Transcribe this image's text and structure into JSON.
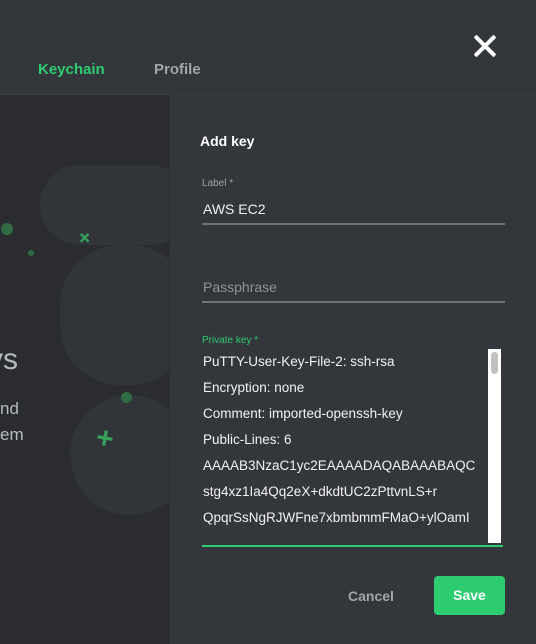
{
  "tabs": {
    "keychain": "Keychain",
    "profile": "Profile"
  },
  "left_panel": {
    "title_fragment": "ys",
    "line1": "nd",
    "line2": "em"
  },
  "modal": {
    "title": "Add key",
    "label_field": {
      "label": "Label *",
      "value": "AWS EC2"
    },
    "passphrase_field": {
      "placeholder": "Passphrase"
    },
    "private_key_field": {
      "label": "Private key *",
      "lines": [
        "PuTTY-User-Key-File-2: ssh-rsa",
        "Encryption: none",
        "Comment: imported-openssh-key",
        "Public-Lines: 6",
        "AAAAB3NzaC1yc2EAAAADAQABAAABAQC",
        "stg4xz1Ia4Qq2eX+dkdtUC2zPttvnLS+r",
        "QpqrSsNgRJWFne7xbmbmmFMaO+ylOamI"
      ]
    },
    "cancel_label": "Cancel",
    "save_label": "Save"
  },
  "colors": {
    "accent": "#2ecc71",
    "background": "#2b2d31",
    "panel": "#33363b"
  }
}
